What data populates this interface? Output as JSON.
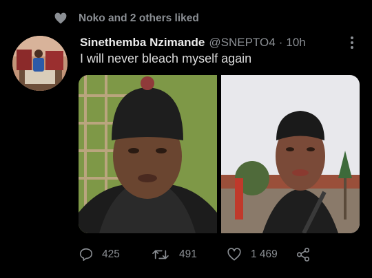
{
  "social_context": {
    "text": "Noko and 2 others liked",
    "icon": "heart-icon"
  },
  "tweet": {
    "author_name": "Sinethemba Nzimande",
    "handle": "@SNEPTO4",
    "separator": "·",
    "time": "10h",
    "text": "I will never bleach myself again",
    "media": [
      {
        "alt": "selfie-beanie"
      },
      {
        "alt": "selfie-outdoor"
      }
    ]
  },
  "actions": {
    "reply": {
      "icon": "reply-icon",
      "count": "425"
    },
    "retweet": {
      "icon": "retweet-icon",
      "count": "491"
    },
    "like": {
      "icon": "heart-outline-icon",
      "count": "1 469"
    },
    "share": {
      "icon": "share-icon"
    }
  },
  "colors": {
    "background": "#000000",
    "muted": "#8b8f94",
    "text": "#d9d9d9"
  }
}
